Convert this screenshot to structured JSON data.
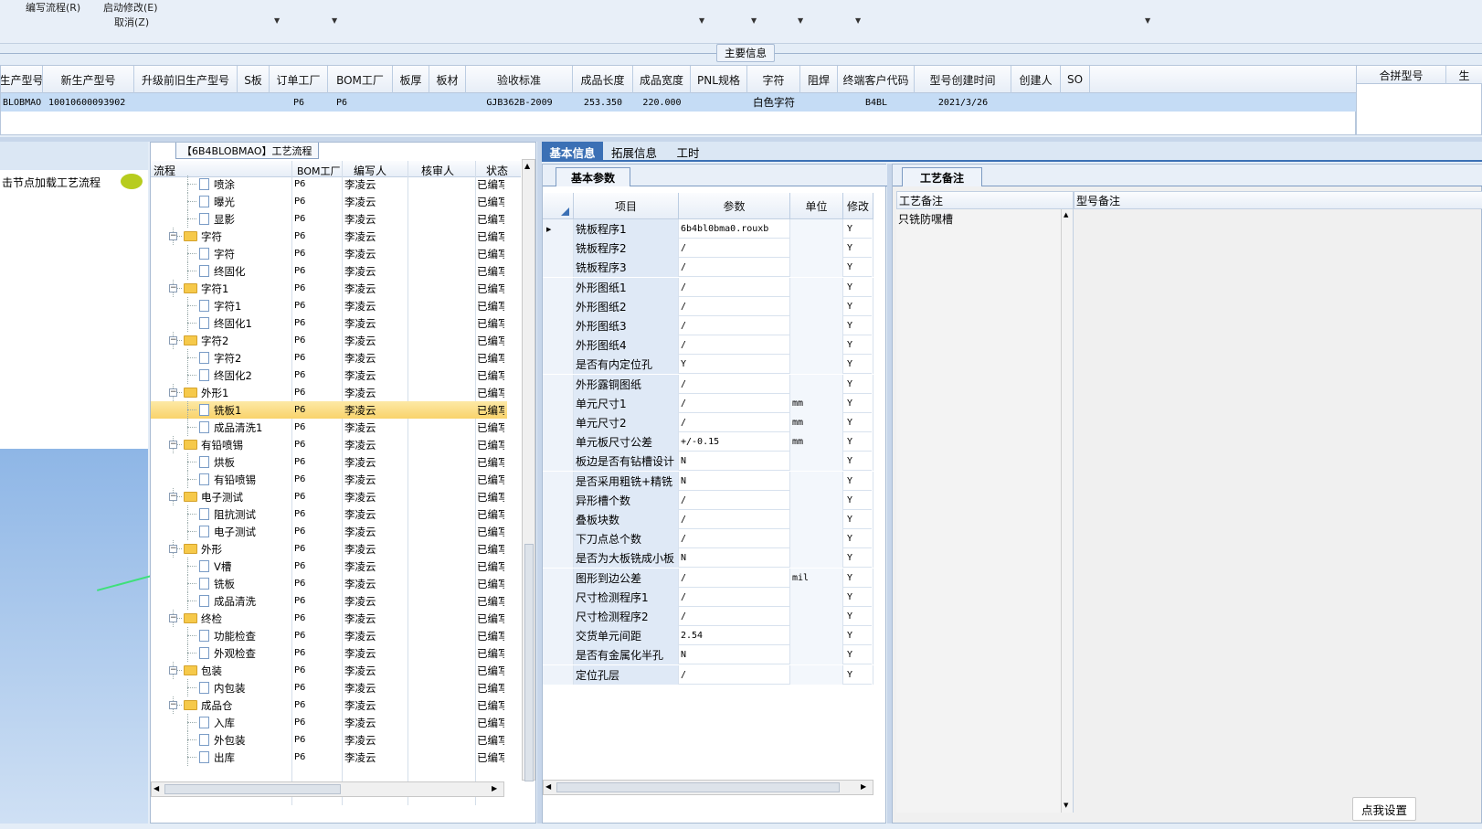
{
  "menu": {
    "write_flow": "编写流程(R)",
    "start_modify": "启动修改(E)",
    "cancel": "取消(Z)"
  },
  "main_info_label": "主要信息",
  "main_table": {
    "headers": [
      "生产型号",
      "新生产型号",
      "升级前旧生产型号",
      "S板",
      "订单工厂",
      "BOM工厂",
      "板厚",
      "板材",
      "验收标准",
      "成品长度",
      "成品宽度",
      "PNL规格",
      "字符",
      "阻焊",
      "终端客户代码",
      "型号创建时间",
      "创建人",
      "SO"
    ],
    "row": [
      "BLOBMAO",
      "10010600093902",
      "",
      "",
      "P6",
      "P6",
      "",
      "",
      "GJB362B-2009",
      "253.350",
      "220.000",
      "",
      "白色字符",
      "",
      "B4BL",
      "2021/3/26",
      "",
      ""
    ]
  },
  "right_table": {
    "headers": [
      "合拼型号",
      "生"
    ]
  },
  "left_panel": {
    "hint": "击节点加载工艺流程"
  },
  "flow_panel": {
    "title": "【6B4BLOBMAO】工艺流程",
    "headers": [
      "流程",
      "BOM工厂",
      "编写人",
      "核审人",
      "状态"
    ],
    "rows": [
      {
        "name": "喷涂",
        "type": "file",
        "level": 2,
        "bom": "P6",
        "writer": "李凌云",
        "status": "已编写"
      },
      {
        "name": "曝光",
        "type": "file",
        "level": 2,
        "bom": "P6",
        "writer": "李凌云",
        "status": "已编写"
      },
      {
        "name": "显影",
        "type": "file",
        "level": 2,
        "bom": "P6",
        "writer": "李凌云",
        "status": "已编写"
      },
      {
        "name": "字符",
        "type": "folder",
        "level": 1,
        "bom": "P6",
        "writer": "李凌云",
        "status": "已编写"
      },
      {
        "name": "字符",
        "type": "file",
        "level": 2,
        "bom": "P6",
        "writer": "李凌云",
        "status": "已编写"
      },
      {
        "name": "终固化",
        "type": "file",
        "level": 2,
        "bom": "P6",
        "writer": "李凌云",
        "status": "已编写"
      },
      {
        "name": "字符1",
        "type": "folder",
        "level": 1,
        "bom": "P6",
        "writer": "李凌云",
        "status": "已编写"
      },
      {
        "name": "字符1",
        "type": "file",
        "level": 2,
        "bom": "P6",
        "writer": "李凌云",
        "status": "已编写"
      },
      {
        "name": "终固化1",
        "type": "file",
        "level": 2,
        "bom": "P6",
        "writer": "李凌云",
        "status": "已编写"
      },
      {
        "name": "字符2",
        "type": "folder",
        "level": 1,
        "bom": "P6",
        "writer": "李凌云",
        "status": "已编写"
      },
      {
        "name": "字符2",
        "type": "file",
        "level": 2,
        "bom": "P6",
        "writer": "李凌云",
        "status": "已编写"
      },
      {
        "name": "终固化2",
        "type": "file",
        "level": 2,
        "bom": "P6",
        "writer": "李凌云",
        "status": "已编写"
      },
      {
        "name": "外形1",
        "type": "folder",
        "level": 1,
        "bom": "P6",
        "writer": "李凌云",
        "status": "已编写"
      },
      {
        "name": "铣板1",
        "type": "file",
        "level": 2,
        "bom": "P6",
        "writer": "李凌云",
        "status": "已编写",
        "selected": true
      },
      {
        "name": "成品清洗1",
        "type": "file",
        "level": 2,
        "bom": "P6",
        "writer": "李凌云",
        "status": "已编写"
      },
      {
        "name": "有铅喷锡",
        "type": "folder",
        "level": 1,
        "bom": "P6",
        "writer": "李凌云",
        "status": "已编写"
      },
      {
        "name": "烘板",
        "type": "file",
        "level": 2,
        "bom": "P6",
        "writer": "李凌云",
        "status": "已编写"
      },
      {
        "name": "有铅喷锡",
        "type": "file",
        "level": 2,
        "bom": "P6",
        "writer": "李凌云",
        "status": "已编写"
      },
      {
        "name": "电子测试",
        "type": "folder",
        "level": 1,
        "bom": "P6",
        "writer": "李凌云",
        "status": "已编写"
      },
      {
        "name": "阻抗测试",
        "type": "file",
        "level": 2,
        "bom": "P6",
        "writer": "李凌云",
        "status": "已编写"
      },
      {
        "name": "电子测试",
        "type": "file",
        "level": 2,
        "bom": "P6",
        "writer": "李凌云",
        "status": "已编写"
      },
      {
        "name": "外形",
        "type": "folder",
        "level": 1,
        "bom": "P6",
        "writer": "李凌云",
        "status": "已编写"
      },
      {
        "name": "V槽",
        "type": "file",
        "level": 2,
        "bom": "P6",
        "writer": "李凌云",
        "status": "已编写"
      },
      {
        "name": "铣板",
        "type": "file",
        "level": 2,
        "bom": "P6",
        "writer": "李凌云",
        "status": "已编写"
      },
      {
        "name": "成品清洗",
        "type": "file",
        "level": 2,
        "bom": "P6",
        "writer": "李凌云",
        "status": "已编写"
      },
      {
        "name": "终检",
        "type": "folder",
        "level": 1,
        "bom": "P6",
        "writer": "李凌云",
        "status": "已编写"
      },
      {
        "name": "功能检查",
        "type": "file",
        "level": 2,
        "bom": "P6",
        "writer": "李凌云",
        "status": "已编写"
      },
      {
        "name": "外观检查",
        "type": "file",
        "level": 2,
        "bom": "P6",
        "writer": "李凌云",
        "status": "已编写"
      },
      {
        "name": "包装",
        "type": "folder",
        "level": 1,
        "bom": "P6",
        "writer": "李凌云",
        "status": "已编写"
      },
      {
        "name": "内包装",
        "type": "file",
        "level": 2,
        "bom": "P6",
        "writer": "李凌云",
        "status": "已编写"
      },
      {
        "name": "成品仓",
        "type": "folder",
        "level": 1,
        "bom": "P6",
        "writer": "李凌云",
        "status": "已编写"
      },
      {
        "name": "入库",
        "type": "file",
        "level": 2,
        "bom": "P6",
        "writer": "李凌云",
        "status": "已编写"
      },
      {
        "name": "外包装",
        "type": "file",
        "level": 2,
        "bom": "P6",
        "writer": "李凌云",
        "status": "已编写"
      },
      {
        "name": "出库",
        "type": "file",
        "level": 2,
        "bom": "P6",
        "writer": "李凌云",
        "status": "已编写"
      }
    ]
  },
  "tabs": [
    "基本信息",
    "拓展信息",
    "工时"
  ],
  "params": {
    "subtab": "基本参数",
    "headers": [
      "项目",
      "参数",
      "单位",
      "修改"
    ],
    "rows": [
      {
        "item": "铣板程序1",
        "value": "6b4bl0bma0.rouxb",
        "unit": "",
        "mod": "Y"
      },
      {
        "item": "铣板程序2",
        "value": "/",
        "unit": "",
        "mod": "Y"
      },
      {
        "item": "铣板程序3",
        "value": "/",
        "unit": "",
        "mod": "Y"
      },
      {
        "item": "外形图纸1",
        "value": "/",
        "unit": "",
        "mod": "Y"
      },
      {
        "item": "外形图纸2",
        "value": "/",
        "unit": "",
        "mod": "Y"
      },
      {
        "item": "外形图纸3",
        "value": "/",
        "unit": "",
        "mod": "Y"
      },
      {
        "item": "外形图纸4",
        "value": "/",
        "unit": "",
        "mod": "Y"
      },
      {
        "item": "是否有内定位孔",
        "value": "Y",
        "unit": "",
        "mod": "Y"
      },
      {
        "item": "外形露铜图纸",
        "value": "/",
        "unit": "",
        "mod": "Y"
      },
      {
        "item": "单元尺寸1",
        "value": "/",
        "unit": "mm",
        "mod": "Y"
      },
      {
        "item": "单元尺寸2",
        "value": "/",
        "unit": "mm",
        "mod": "Y"
      },
      {
        "item": "单元板尺寸公差",
        "value": "+/-0.15",
        "unit": "mm",
        "mod": "Y"
      },
      {
        "item": "板边是否有钻槽设计",
        "value": "N",
        "unit": "",
        "mod": "Y"
      },
      {
        "item": "是否采用粗铣+精铣",
        "value": "N",
        "unit": "",
        "mod": "Y"
      },
      {
        "item": "异形槽个数",
        "value": "/",
        "unit": "",
        "mod": "Y"
      },
      {
        "item": "叠板块数",
        "value": "/",
        "unit": "",
        "mod": "Y"
      },
      {
        "item": "下刀点总个数",
        "value": "/",
        "unit": "",
        "mod": "Y"
      },
      {
        "item": "是否为大板铣成小板",
        "value": "N",
        "unit": "",
        "mod": "Y"
      },
      {
        "item": "图形到边公差",
        "value": "/",
        "unit": "mil",
        "mod": "Y"
      },
      {
        "item": "尺寸检测程序1",
        "value": "/",
        "unit": "",
        "mod": "Y"
      },
      {
        "item": "尺寸检测程序2",
        "value": "/",
        "unit": "",
        "mod": "Y"
      },
      {
        "item": "交货单元间距",
        "value": "2.54",
        "unit": "",
        "mod": "Y"
      },
      {
        "item": "是否有金属化半孔",
        "value": "N",
        "unit": "",
        "mod": "Y"
      },
      {
        "item": "定位孔层",
        "value": "/",
        "unit": "",
        "mod": "Y"
      }
    ]
  },
  "notes": {
    "subtab": "工艺备注",
    "headers": [
      "工艺备注",
      "型号备注"
    ],
    "process_note": "只铣防嘿槽"
  },
  "settings_button": "点我设置"
}
